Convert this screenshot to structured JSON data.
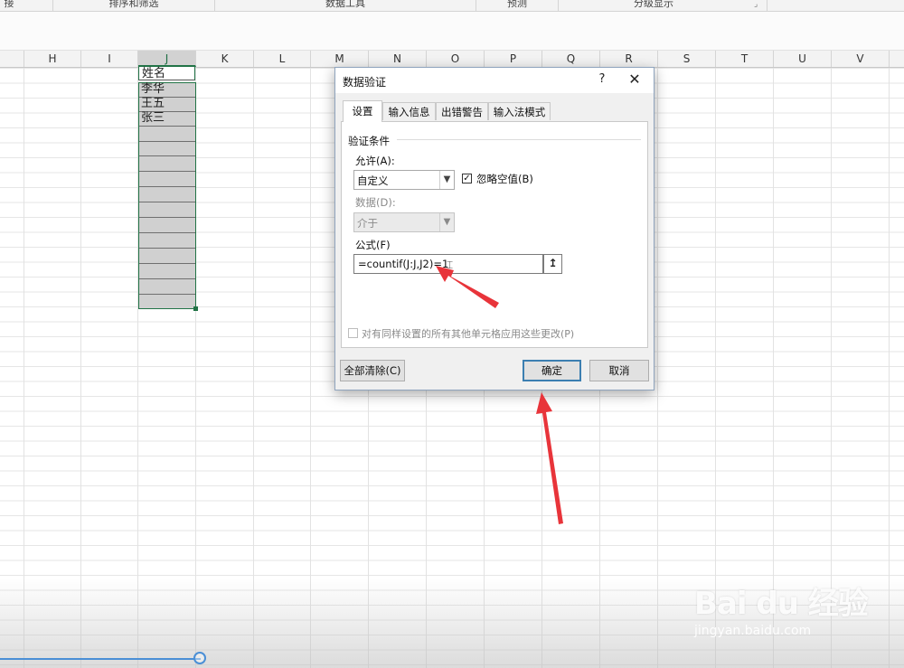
{
  "ribbon": {
    "groups": [
      "接",
      "排序和筛选",
      "数据工具",
      "预测",
      "分级显示"
    ]
  },
  "columns": [
    "H",
    "I",
    "J",
    "K",
    "L",
    "M",
    "N",
    "O",
    "P",
    "Q",
    "R",
    "S",
    "T",
    "U",
    "V"
  ],
  "sheet": {
    "header_cell": "姓名",
    "names": [
      "李华",
      "王五",
      "张三"
    ]
  },
  "dialog": {
    "title": "数据验证",
    "help": "?",
    "close": "✕",
    "tabs": [
      "设置",
      "输入信息",
      "出错警告",
      "输入法模式"
    ],
    "section_label": "验证条件",
    "allow_label": "允许(A):",
    "allow_value": "自定义",
    "ignore_blank_label": "忽略空值(B)",
    "ignore_blank_checked": true,
    "data_label": "数据(D):",
    "data_value": "介于",
    "formula_label": "公式(F)",
    "formula_value": "=countif(J:J,J2)=1",
    "apply_all_label": "对有同样设置的所有其他单元格应用这些更改(P)",
    "clear_all_label": "全部清除(C)",
    "ok_label": "确定",
    "cancel_label": "取消"
  },
  "watermark": {
    "logo": "Bai du 经验",
    "url": "jingyan.baidu.com"
  },
  "colors": {
    "selection_green": "#217346",
    "annotation_arrow": "#e8343a",
    "default_button_border": "#3c7fb1"
  }
}
